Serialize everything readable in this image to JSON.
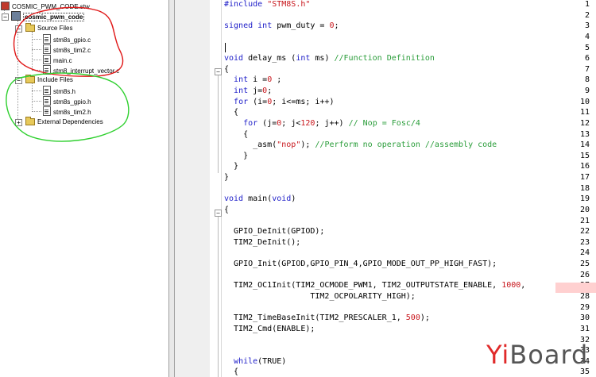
{
  "tree": {
    "workspace": "COSMIC_PWM_CODE.stw",
    "project": "cosmic_pwm_code",
    "source_folder": "Source Files",
    "source_files": [
      "stm8s_gpio.c",
      "stm8s_tim2.c",
      "main.c",
      "stm8_interrupt_vector.c"
    ],
    "include_folder": "Include Files",
    "include_files": [
      "stm8s.h",
      "stm8s_gpio.h",
      "stm8s_tim2.h"
    ],
    "external_folder": "External Dependencies"
  },
  "editor": {
    "lines": [
      {
        "n": "1",
        "code": "#include \"STM8S.h\""
      },
      {
        "n": "2",
        "code": ""
      },
      {
        "n": "3",
        "code": "signed int pwm_duty = 0;"
      },
      {
        "n": "4",
        "code": ""
      },
      {
        "n": "5",
        "code": ""
      },
      {
        "n": "6",
        "code": "void delay_ms (int ms) //Function Definition"
      },
      {
        "n": "7",
        "code": "{"
      },
      {
        "n": "8",
        "code": "  int i =0 ;"
      },
      {
        "n": "9",
        "code": "  int j=0;"
      },
      {
        "n": "10",
        "code": "  for (i=0; i<=ms; i++)"
      },
      {
        "n": "11",
        "code": "  {"
      },
      {
        "n": "12",
        "code": "    for (j=0; j<120; j++) // Nop = Fosc/4"
      },
      {
        "n": "13",
        "code": "    {"
      },
      {
        "n": "14",
        "code": "      _asm(\"nop\"); //Perform no operation //assembly code"
      },
      {
        "n": "15",
        "code": "    }"
      },
      {
        "n": "16",
        "code": "  }"
      },
      {
        "n": "17",
        "code": "}"
      },
      {
        "n": "18",
        "code": ""
      },
      {
        "n": "19",
        "code": "void main(void)"
      },
      {
        "n": "20",
        "code": "{"
      },
      {
        "n": "21",
        "code": ""
      },
      {
        "n": "22",
        "code": "  GPIO_DeInit(GPIOD);"
      },
      {
        "n": "23",
        "code": "  TIM2_DeInit();"
      },
      {
        "n": "24",
        "code": ""
      },
      {
        "n": "25",
        "code": "  GPIO_Init(GPIOD,GPIO_PIN_4,GPIO_MODE_OUT_PP_HIGH_FAST);"
      },
      {
        "n": "26",
        "code": ""
      },
      {
        "n": "27",
        "code": "  TIM2_OC1Init(TIM2_OCMODE_PWM1, TIM2_OUTPUTSTATE_ENABLE, 1000,"
      },
      {
        "n": "28",
        "code": "                  TIM2_OCPOLARITY_HIGH);"
      },
      {
        "n": "29",
        "code": ""
      },
      {
        "n": "30",
        "code": "  TIM2_TimeBaseInit(TIM2_PRESCALER_1, 500);"
      },
      {
        "n": "31",
        "code": "  TIM2_Cmd(ENABLE);"
      },
      {
        "n": "32",
        "code": ""
      },
      {
        "n": "33",
        "code": ""
      },
      {
        "n": "34",
        "code": "  while(TRUE)"
      },
      {
        "n": "35",
        "code": "  {"
      }
    ]
  },
  "watermark": {
    "prefix": "Yi",
    "suffix": "Board"
  },
  "colors": {
    "keyword": "#1c1cc8",
    "string": "#c8161c",
    "comment": "#2a9d3a",
    "annotation_red": "#e01818",
    "annotation_green": "#2fd02f"
  }
}
